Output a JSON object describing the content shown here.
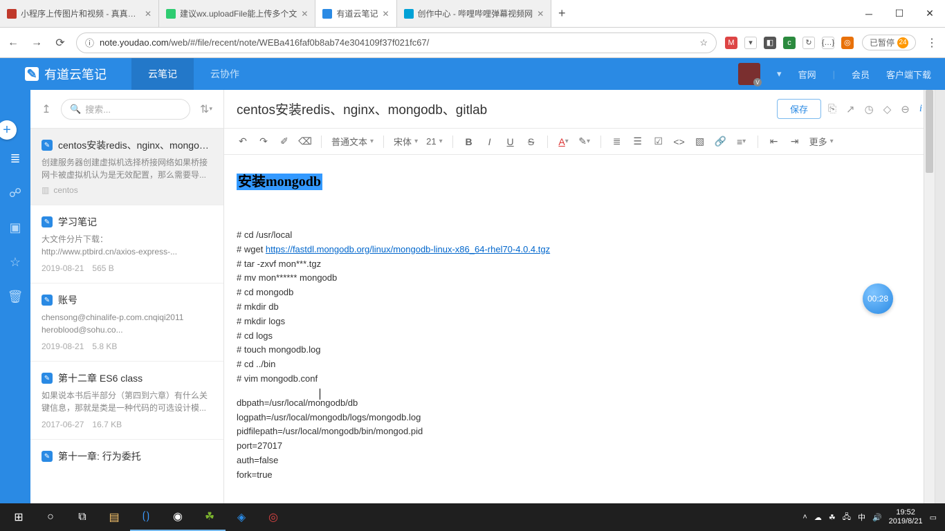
{
  "browser": {
    "tabs": [
      {
        "title": "小程序上传图片和视频 - 真真的技",
        "icon": "#c0392b"
      },
      {
        "title": "建议wx.uploadFile能上传多个文",
        "icon": "#2ecc71"
      },
      {
        "title": "有道云笔记",
        "icon": "#2a8ae4",
        "active": true
      },
      {
        "title": "创作中心 - 哔哩哔哩弹幕视频网",
        "icon": "#00a1d6"
      }
    ],
    "url_info": "ⓘ",
    "url_host": "note.youdao.com",
    "url_path": "/web/#/file/recent/note/WEBa416faf0b8ab74e304109f37f021fc67/",
    "pause_label": "已暂停"
  },
  "app": {
    "logo": "有道云笔记",
    "tabs": {
      "notes": "云笔记",
      "collab": "云协作"
    },
    "header": {
      "site": "官网",
      "vip": "会员",
      "download": "客户端下载"
    }
  },
  "list": {
    "search_placeholder": "搜索...",
    "items": [
      {
        "title": "centos安装redis、nginx、mongodb...",
        "preview": "创建服务器创建虚拟机选择桥接网络如果桥接网卡被虚拟机认为是无效配置，那么需要导...",
        "folder": "centos",
        "selected": true
      },
      {
        "title": "学习笔记",
        "preview": "大文件分片下载：\nhttp://www.ptbird.cn/axios-express-...",
        "date": "2019-08-21",
        "size": "565 B"
      },
      {
        "title": "账号",
        "preview": "chensong@chinalife-p.com.cnqiqi2011 heroblood@sohu.co...",
        "date": "2019-08-21",
        "size": "5.8 KB"
      },
      {
        "title": "第十二章 ES6 class",
        "preview": "如果说本书后半部分（第四到六章）有什么关键信息，那就是类是一种代码的可选设计模...",
        "date": "2017-06-27",
        "size": "16.7 KB"
      },
      {
        "title": "第十一章: 行为委托",
        "preview": ""
      }
    ]
  },
  "editor": {
    "title": "centos安装redis、nginx、mongodb、gitlab",
    "save": "保存",
    "fmt": {
      "style": "普通文本",
      "font": "宋体",
      "size": "21",
      "more": "更多"
    },
    "heading": "安装mongodb",
    "lines": {
      "l1": "# cd /usr/local",
      "l2a": "# wget ",
      "l2b": "https://fastdl.mongodb.org/linux/mongodb-linux-x86_64-rhel70-4.0.4.tgz",
      "l3": "# tar -zxvf mon***.tgz",
      "l4": "# mv mon****** mongodb",
      "l5": "# cd mongodb",
      "l6": "# mkdir db",
      "l7": "#   mkdir logs",
      "l8": "# cd logs",
      "l9": "# touch mongodb.log",
      "l10": "# cd ../bin",
      "l11": "# vim mongodb.conf",
      "c1": "dbpath=/usr/local/mongodb/db",
      "c2": "logpath=/usr/local/mongodb/logs/mongodb.log",
      "c3": "pidfilepath=/usr/local/mongodb/bin/mongod.pid",
      "c4": "port=27017",
      "c5": "auth=false",
      "c6": "fork=true"
    },
    "timer": "00:28"
  },
  "taskbar": {
    "time": "19:52",
    "date": "2019/8/21"
  }
}
